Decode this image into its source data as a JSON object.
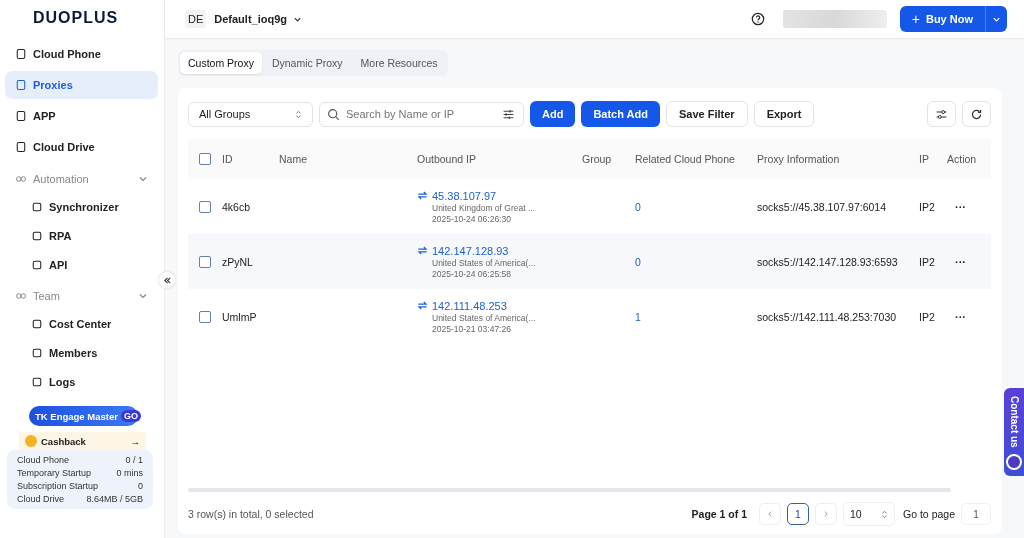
{
  "brand": {
    "logo": "DUOPLUS"
  },
  "workspace": {
    "badge": "DE",
    "name": "Default_ioq9g"
  },
  "header": {
    "buy_icon": "+",
    "buy_button": "Buy Now"
  },
  "sidebar": {
    "items": [
      {
        "label": "Cloud Phone",
        "selected": false
      },
      {
        "label": "Proxies",
        "selected": true
      },
      {
        "label": "APP",
        "selected": false
      },
      {
        "label": "Cloud Drive",
        "selected": false
      },
      {
        "label": "Automation",
        "selected": false,
        "expanded": true,
        "children": [
          {
            "label": "Synchronizer",
            "selected": false
          },
          {
            "label": "RPA",
            "selected": false
          },
          {
            "label": "API",
            "selected": false
          }
        ]
      },
      {
        "label": "Team",
        "selected": false,
        "expanded": true,
        "children": [
          {
            "label": "Cost Center",
            "selected": false
          },
          {
            "label": "Members",
            "selected": false
          },
          {
            "label": "Logs",
            "selected": false
          }
        ]
      }
    ],
    "promo": {
      "title": "TK Engage Master",
      "badge": "GO"
    },
    "cashback": {
      "label": "Cashback",
      "arrow": "→"
    },
    "usage": [
      {
        "label": "Cloud Phone",
        "value": "0 / 1"
      },
      {
        "label": "Temporary Startup",
        "value": "0 mins"
      },
      {
        "label": "Subscription Startup",
        "value": "0"
      },
      {
        "label": "Cloud Drive",
        "value": "8.64MB / 5GB"
      }
    ]
  },
  "tabs": [
    {
      "label": "Custom Proxy",
      "selected": true
    },
    {
      "label": "Dynamic Proxy",
      "selected": false
    },
    {
      "label": "More Resources",
      "selected": false
    }
  ],
  "toolbar": {
    "group_select": "All Groups",
    "search": {
      "placeholder": "Search by Name or IP"
    },
    "buttons": [
      {
        "label": "Add",
        "kind": "primary"
      },
      {
        "label": "Batch Add",
        "kind": "primary"
      },
      {
        "label": "Save Filter",
        "kind": "default"
      },
      {
        "label": "Export",
        "kind": "default"
      }
    ]
  },
  "table": {
    "all_checked": false,
    "columns": [
      "ID",
      "Name",
      "Outbound IP",
      "Group",
      "Related Cloud Phone",
      "Proxy Information",
      "IP",
      "Action"
    ],
    "rows": [
      {
        "checked": false,
        "id": "4k6cb",
        "ip": "45.38.107.97",
        "country": "United Kingdom of Great ...",
        "time": "2025-10-24 06:26:30",
        "related": "0",
        "proxy": "socks5://45.38.107.97:6014",
        "column_8": "IP2",
        "action": "···"
      },
      {
        "checked": false,
        "id": "zPyNL",
        "ip": "142.147.128.93",
        "country": "United States of America(...",
        "time": "2025-10-24 06:25:58",
        "related": "0",
        "proxy": "socks5://142.147.128.93:6593",
        "column_8": "IP2",
        "action": "···"
      },
      {
        "checked": false,
        "id": "UmlmP",
        "ip": "142.111.48.253",
        "country": "United States of America(...",
        "time": "2025-10-21 03:47:26",
        "related": "1",
        "proxy": "socks5://142.111.48.253:7030",
        "column_8": "IP2",
        "action": "···"
      }
    ]
  },
  "footer": {
    "summary": "3 row(s) in total, 0 selected",
    "page_info": "Page 1 of 1",
    "pages": [
      {
        "label": "1",
        "selected": true
      }
    ],
    "page_size": "10",
    "goto_label": "Go to page",
    "goto_value": "1"
  },
  "contact": {
    "label": "Contact us"
  }
}
